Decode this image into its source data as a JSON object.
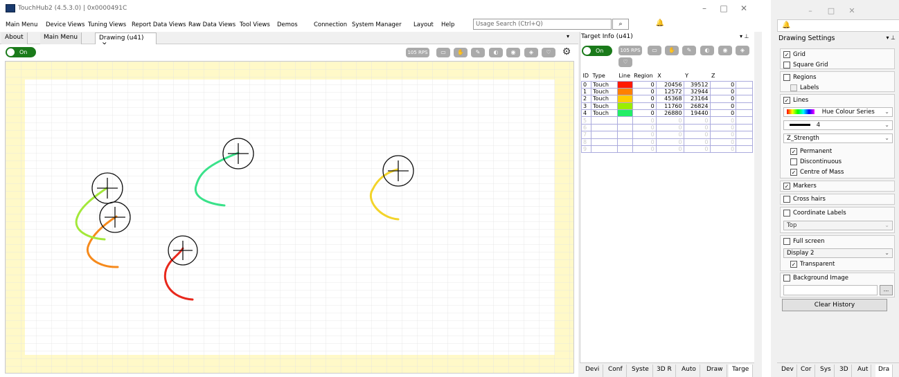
{
  "window": {
    "title": "TouchHub2 (4.5.3.0) | 0x0000491C",
    "controls": {
      "minimize": "–",
      "maximize": "□",
      "close": "✕"
    }
  },
  "menu": {
    "items": [
      "Main Menu",
      "Device Views",
      "Tuning Views",
      "Report Data Views",
      "Raw Data Views",
      "Tool Views",
      "Demos"
    ],
    "items2": [
      "Connection",
      "System Manager"
    ],
    "items3": [
      "Layout",
      "Help"
    ],
    "search_placeholder": "Usage Search (Ctrl+Q)"
  },
  "tabs": {
    "items": [
      {
        "label": "About",
        "active": false
      },
      {
        "label": "Main Menu",
        "active": false
      },
      {
        "label": "Drawing (u41)",
        "active": true
      }
    ],
    "close": "✕"
  },
  "drawing": {
    "toggle_label": "On",
    "rps_label": "105 RPS",
    "gear_icon": "gear-icon"
  },
  "target_info": {
    "title": "Target Info (u41)",
    "toggle_label": "On",
    "rps_label": "105 RPS",
    "columns": [
      "ID",
      "Type",
      "Line",
      "Region",
      "X",
      "Y",
      "Z"
    ],
    "rows": [
      {
        "id": "0",
        "type": "Touch",
        "color": "#ff1a00",
        "region": "0",
        "x": "20456",
        "y": "39512",
        "z": "0"
      },
      {
        "id": "1",
        "type": "Touch",
        "color": "#ff8000",
        "region": "0",
        "x": "12572",
        "y": "32944",
        "z": "0"
      },
      {
        "id": "2",
        "type": "Touch",
        "color": "#ffcc00",
        "region": "0",
        "x": "45368",
        "y": "23164",
        "z": "0"
      },
      {
        "id": "3",
        "type": "Touch",
        "color": "#99ee00",
        "region": "0",
        "x": "11760",
        "y": "26824",
        "z": "0"
      },
      {
        "id": "4",
        "type": "Touch",
        "color": "#22ee66",
        "region": "0",
        "x": "26880",
        "y": "19440",
        "z": "0"
      },
      {
        "id": "5",
        "type": "",
        "color": "",
        "region": "0",
        "x": "0",
        "y": "0",
        "z": "0"
      },
      {
        "id": "6",
        "type": "",
        "color": "",
        "region": "0",
        "x": "0",
        "y": "0",
        "z": "0"
      },
      {
        "id": "7",
        "type": "",
        "color": "",
        "region": "0",
        "x": "0",
        "y": "0",
        "z": "0"
      },
      {
        "id": "8",
        "type": "",
        "color": "",
        "region": "0",
        "x": "0",
        "y": "0",
        "z": "0"
      },
      {
        "id": "9",
        "type": "",
        "color": "",
        "region": "0",
        "x": "0",
        "y": "0",
        "z": "0"
      }
    ],
    "bottom_tabs": [
      "Devi",
      "Conf",
      "Syste",
      "3D R",
      "Auto",
      "Draw",
      "Targe"
    ]
  },
  "drawing_settings": {
    "title": "Drawing Settings",
    "grid": {
      "label": "Grid",
      "checked": true
    },
    "square_grid": {
      "label": "Square Grid",
      "checked": false
    },
    "regions": {
      "label": "Regions",
      "checked": false
    },
    "labels": {
      "label": "Labels",
      "checked": false
    },
    "lines": {
      "label": "Lines",
      "checked": true
    },
    "line_colour": "Hue Colour Series",
    "line_width": "4",
    "line_mode": "Z_Strength",
    "permanent": {
      "label": "Permanent",
      "checked": true
    },
    "discontinuous": {
      "label": "Discontinuous",
      "checked": false
    },
    "centre_of_mass": {
      "label": "Centre of Mass",
      "checked": true
    },
    "markers": {
      "label": "Markers",
      "checked": true
    },
    "cross_hairs": {
      "label": "Cross hairs",
      "checked": false
    },
    "coordinate_labels": {
      "label": "Coordinate Labels",
      "checked": false
    },
    "coord_position": "Top",
    "full_screen": {
      "label": "Full screen",
      "checked": false
    },
    "display": "Display 2",
    "transparent": {
      "label": "Transparent",
      "checked": true
    },
    "background_image": {
      "label": "Background Image",
      "checked": false
    },
    "browse_label": "...",
    "clear_label": "Clear History",
    "bottom_tabs": [
      "Dev",
      "Cor",
      "Sys",
      "3D",
      "Aut",
      "Dra"
    ]
  }
}
